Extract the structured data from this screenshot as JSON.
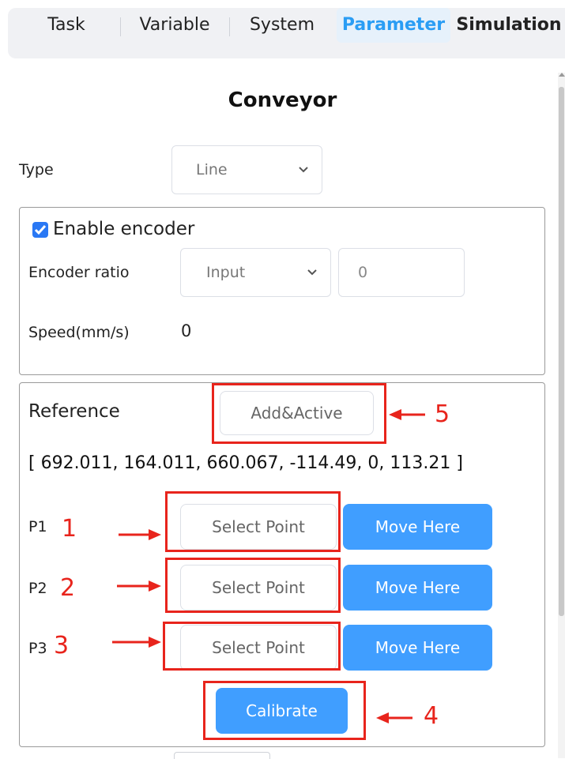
{
  "tabs": [
    {
      "label": "Task",
      "active": false
    },
    {
      "label": "Variable",
      "active": false
    },
    {
      "label": "System",
      "active": false
    },
    {
      "label": "Parameter",
      "active": true
    },
    {
      "label": "Simulation",
      "active": false
    }
  ],
  "page": {
    "title": "Conveyor"
  },
  "type_field": {
    "label": "Type",
    "value": "Line"
  },
  "encoder": {
    "enable_label": "Enable encoder",
    "enabled": true,
    "ratio_label": "Encoder ratio",
    "ratio_mode": "Input",
    "ratio_value": "0",
    "speed_label": "Speed(mm/s)",
    "speed_value": "0"
  },
  "reference": {
    "label": "Reference",
    "add_active_button": "Add&Active",
    "values": "[ 692.011, 164.011, 660.067, -114.49, 0, 113.21 ]",
    "points": [
      {
        "label": "P1",
        "select_button": "Select Point",
        "move_button": "Move Here"
      },
      {
        "label": "P2",
        "select_button": "Select Point",
        "move_button": "Move Here"
      },
      {
        "label": "P3",
        "select_button": "Select Point",
        "move_button": "Move Here"
      }
    ],
    "calibrate_button": "Calibrate"
  },
  "annotations": {
    "n1": "1",
    "n2": "2",
    "n3": "3",
    "n4": "4",
    "n5": "5",
    "color": "#e8241c"
  },
  "colors": {
    "accent": "#2a9df4",
    "button_blue": "#409eff",
    "checkbox": "#2a78f4"
  }
}
